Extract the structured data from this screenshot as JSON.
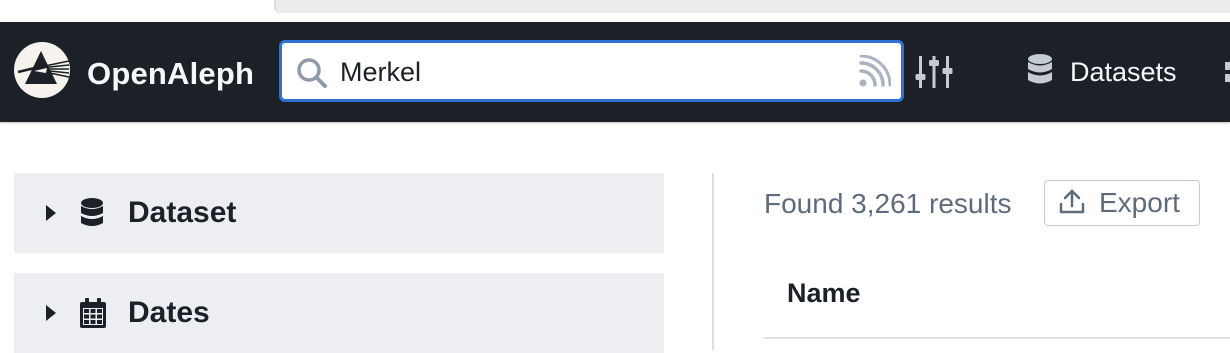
{
  "app": {
    "brand": "OpenAleph",
    "logo_icon": "prism-logo-icon"
  },
  "search": {
    "value": "Merkel",
    "placeholder": "",
    "icon": "search-icon",
    "feed_icon": "rss-feed-icon",
    "focus_color": "#2d72d2"
  },
  "navbar": {
    "background": "#1c2127",
    "filter_icon": "sliders-icon",
    "datasets_label": "Datasets",
    "datasets_icon": "database-icon"
  },
  "facets": [
    {
      "label": "Dataset",
      "icon": "database-icon",
      "expanded": false
    },
    {
      "label": "Dates",
      "icon": "calendar-icon",
      "expanded": false
    }
  ],
  "results": {
    "count_text": "Found 3,261 results",
    "export_label": "Export",
    "export_icon": "upload-icon",
    "columns": [
      "Name"
    ]
  }
}
